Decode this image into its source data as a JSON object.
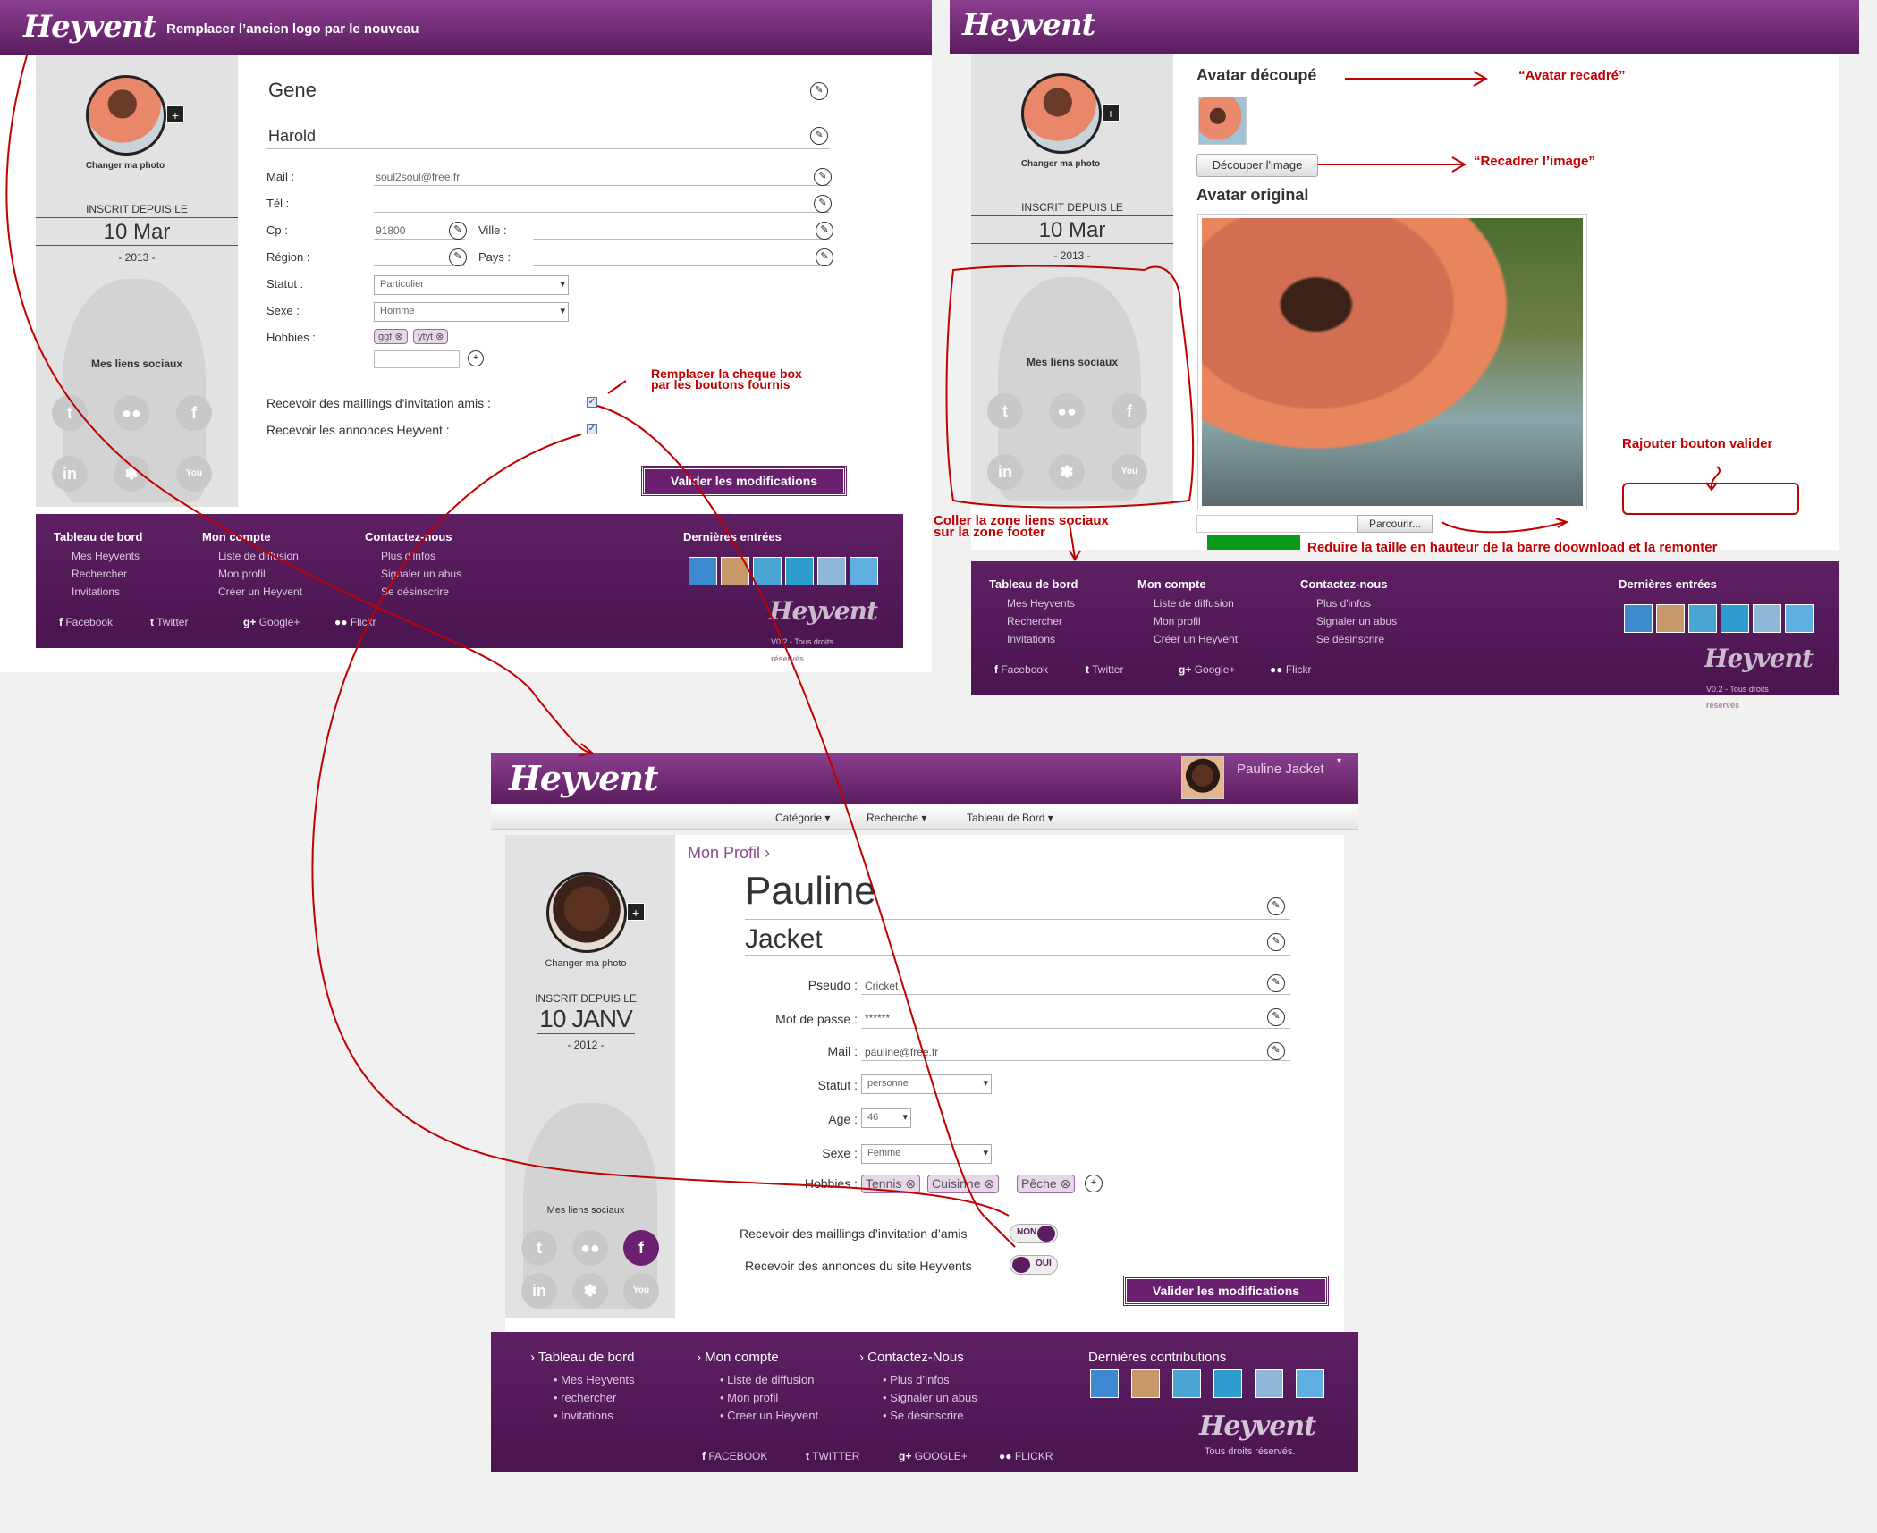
{
  "shot1": {
    "header_note": "Remplacer l’ancien logo par le nouveau",
    "logo": "Heyvent",
    "change_photo": "Changer ma photo",
    "since_label": "INSCRIT DEPUIS LE",
    "since_date": "10 Mar",
    "since_year": "- 2013 -",
    "social_title": "Mes liens sociaux",
    "first_name": "Gene",
    "last_name": "Harold",
    "fields": {
      "mail_label": "Mail :",
      "mail_value": "soul2soul@free.fr",
      "tel_label": "Tél :",
      "cp_label": "Cp :",
      "cp_value": "91800",
      "ville_label": "Ville :",
      "region_label": "Région :",
      "pays_label": "Pays :",
      "statut_label": "Statut :",
      "statut_value": "Particulier",
      "sexe_label": "Sexe :",
      "sexe_value": "Homme",
      "hobbies_label": "Hobbies :",
      "hobby1": "ggf",
      "hobby2": "ytyt"
    },
    "mailing_label": "Recevoir des maillings d'invitation amis :",
    "annonces_label": "Recevoir les annonces Heyvent :",
    "submit": "Valider les modifications",
    "note_checkbox": "Remplacer la cheque box\npar les boutons fournis"
  },
  "shot2": {
    "logo": "Heyvent",
    "change_photo": "Changer ma photo",
    "since_label": "INSCRIT DEPUIS LE",
    "since_date": "10 Mar",
    "since_year": "- 2013 -",
    "social_title": "Mes liens sociaux",
    "avatar_cut": "Avatar découpé",
    "note_avatar": "“Avatar recadré”",
    "cut_button": "Découper l'image",
    "note_recadrer": "“Recadrer l’image”",
    "avatar_original": "Avatar original",
    "browse": "Parcourir...",
    "note_valider": "Rajouter bouton valider",
    "note_coller": "Coller la zone liens sociaux\nsur la zone footer",
    "note_reduire": "Reduire la taille en hauteur de la barre doownload et la remonter"
  },
  "footer_old": {
    "col1_title": "Tableau de bord",
    "col1": [
      "Mes Heyvents",
      "Rechercher",
      "Invitations"
    ],
    "col2_title": "Mon compte",
    "col2": [
      "Liste de diffusion",
      "Mon profil",
      "Créer un Heyvent"
    ],
    "col3_title": "Contactez-nous",
    "col3": [
      "Plus d'infos",
      "Signaler un abus",
      "Se désinscrire"
    ],
    "recent_title": "Dernières entrées",
    "socials": [
      "Facebook",
      "Twitter",
      "Google+",
      "Flickr"
    ],
    "version": "V0.2 - Tous droits",
    "reserved": "réservés",
    "logo": "Heyvent"
  },
  "shot3": {
    "logo": "Heyvent",
    "user_name": "Pauline Jacket",
    "nav": [
      "Catégorie",
      "Recherche",
      "Tableau de Bord"
    ],
    "breadcrumb": "Mon Profil",
    "change_photo": "Changer ma photo",
    "since_label": "INSCRIT DEPUIS LE",
    "since_date": "10 JANV",
    "since_year": "- 2012 -",
    "social_title": "Mes liens sociaux",
    "first_name": "Pauline",
    "last_name": "Jacket",
    "pseudo_label": "Pseudo :",
    "pseudo_value": "Cricket",
    "pwd_label": "Mot de passe :",
    "pwd_value": "******",
    "mail_label": "Mail :",
    "mail_value": "pauline@free.fr",
    "statut_label": "Statut :",
    "statut_value": "personne",
    "age_label": "Age :",
    "age_value": "46",
    "sexe_label": "Sexe :",
    "sexe_value": "Femme",
    "hobbies_label": "Hobbies :",
    "hobbies": [
      "Tennis",
      "Cuisinne",
      "Pêche"
    ],
    "mailing_label": "Recevoir des maillings d’invitation d’amis",
    "mailing_state": "NON",
    "annonces_label": "Recevoir des annonces du site Heyvents",
    "annonces_state": "OUI",
    "submit": "Valider les modifications",
    "footer": {
      "col1_title": "Tableau de bord",
      "col1": [
        "Mes Heyvents",
        "rechercher",
        "Invitations"
      ],
      "col2_title": "Mon compte",
      "col2": [
        "Liste de diffusion",
        "Mon profil",
        "Creer un Heyvent"
      ],
      "col3_title": "Contactez-Nous",
      "col3": [
        "Plus d’infos",
        "Signaler un abus",
        "Se désinscrire"
      ],
      "recent_title": "Dernières contributions",
      "socials": [
        "FACEBOOK",
        "TWITTER",
        "GOOGLE+",
        "FLICKR"
      ],
      "rights": "Tous droits réservés."
    }
  },
  "colors": {
    "brand": "#5e1f63",
    "annotation": "#c10000"
  }
}
